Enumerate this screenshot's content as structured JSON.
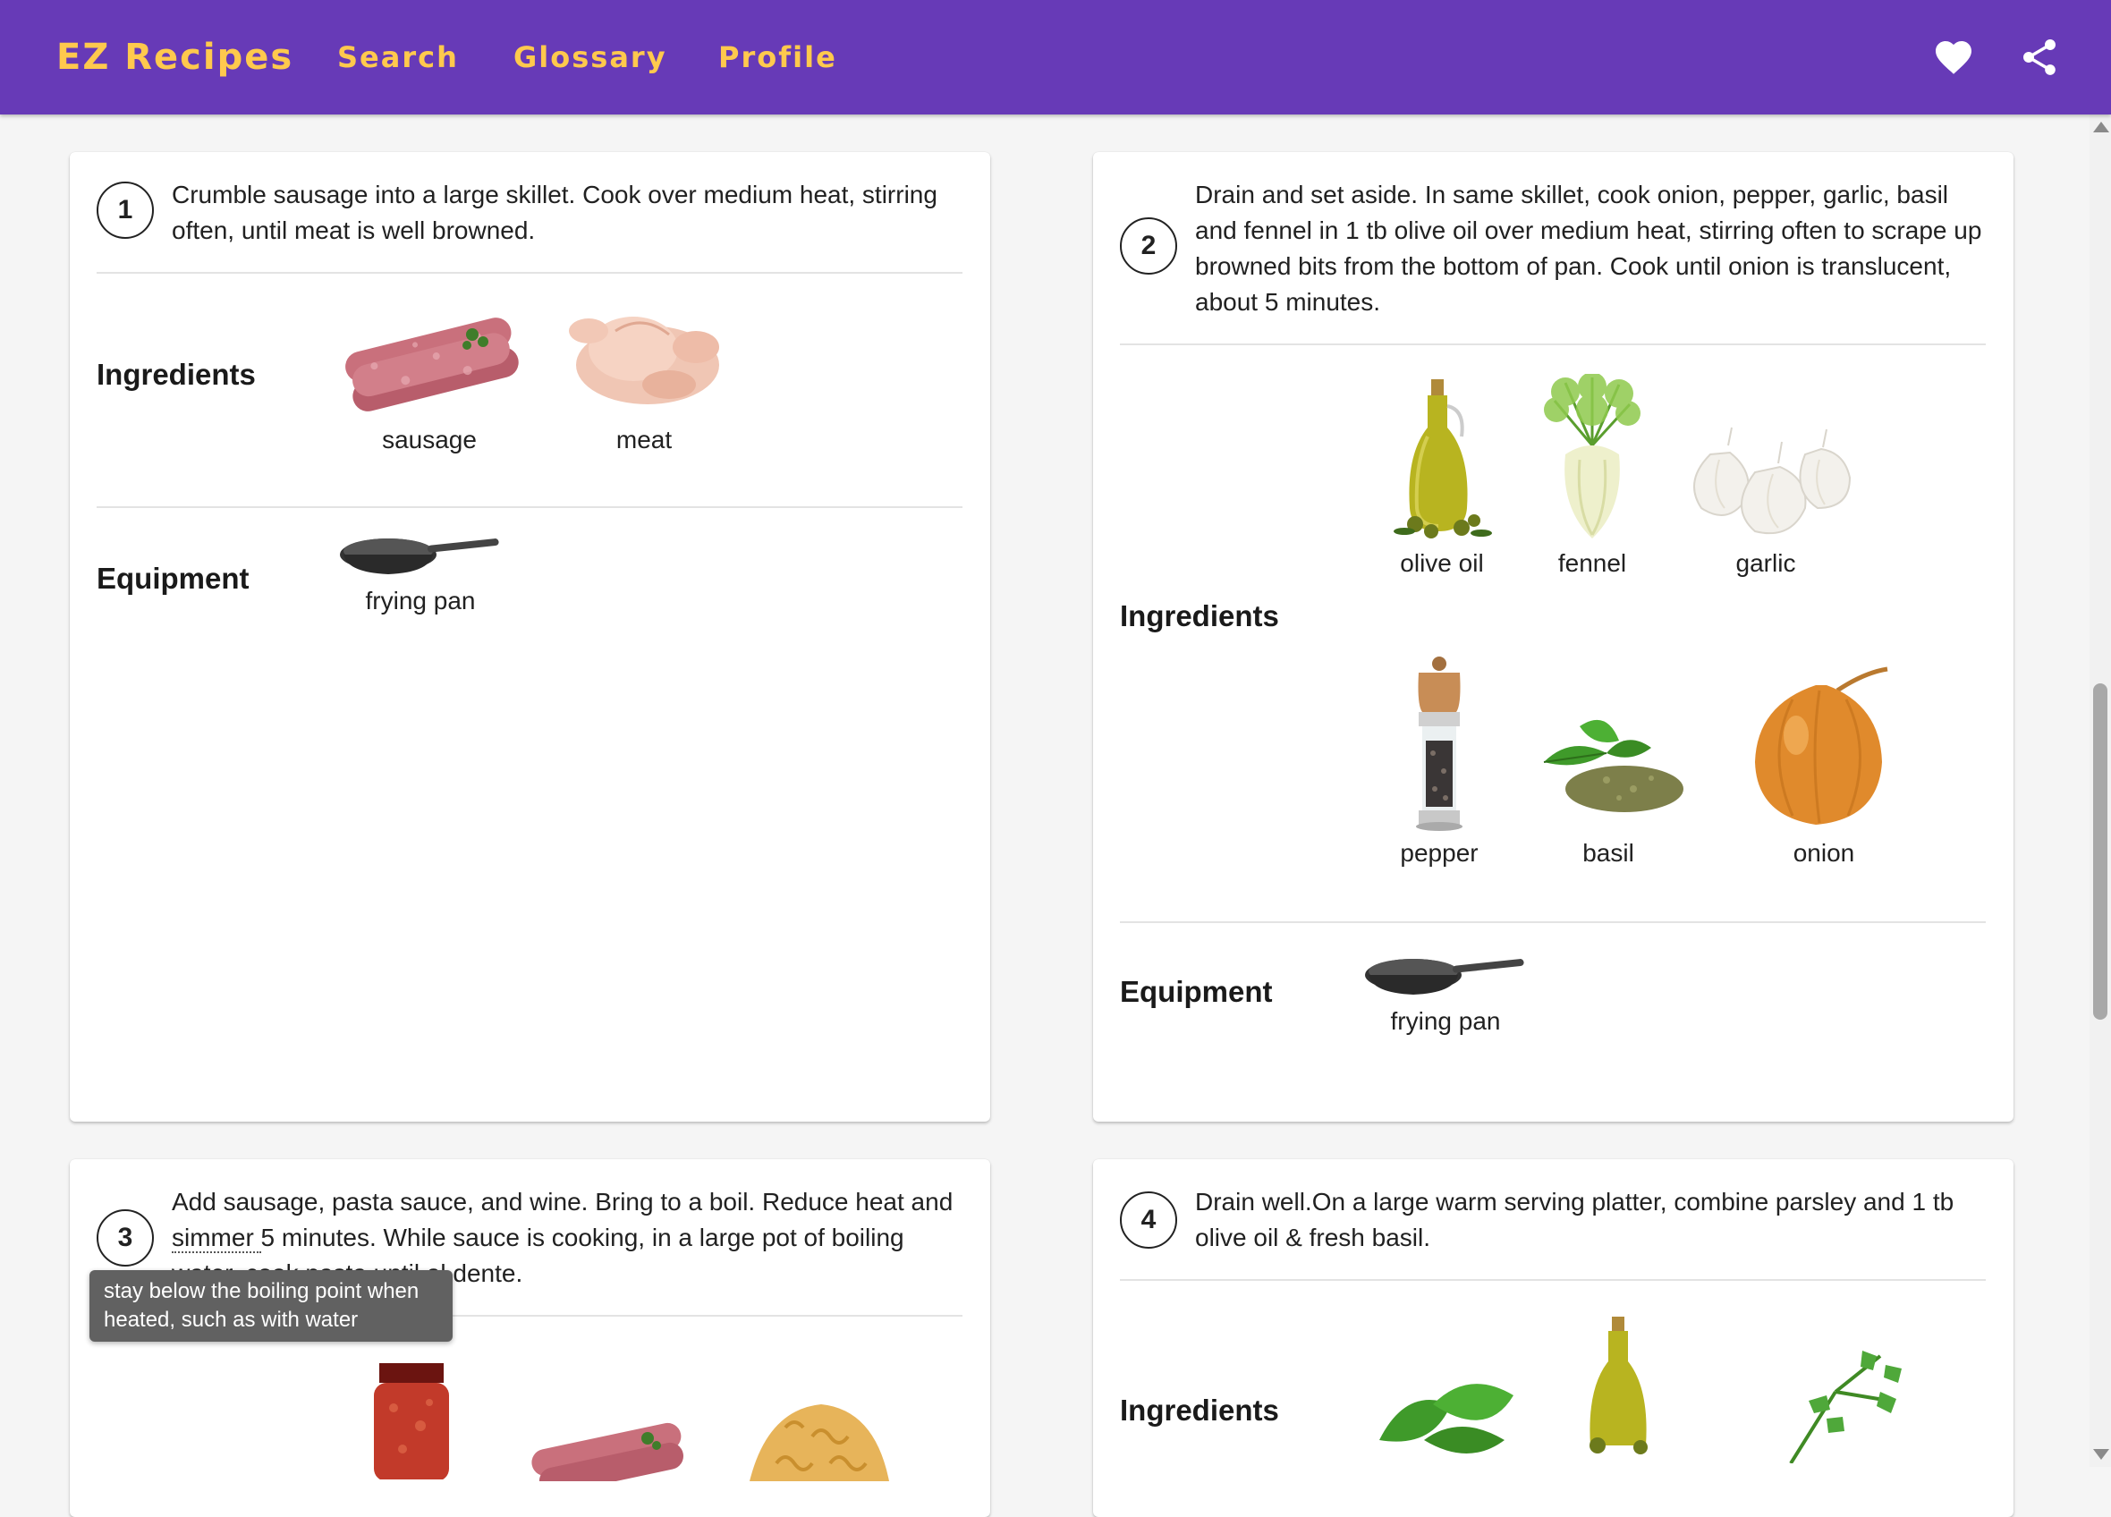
{
  "app": {
    "brand": "EZ Recipes",
    "nav": [
      "Search",
      "Glossary",
      "Profile"
    ],
    "actions": [
      "heart-icon",
      "share-icon"
    ],
    "colors": {
      "appbar": "#673ab7",
      "nav_text": "#ffc94d"
    }
  },
  "labels": {
    "ingredients": "Ingredients",
    "equipment": "Equipment"
  },
  "steps": [
    {
      "number": "1",
      "text": "Crumble sausage into a large skillet. Cook over medium heat, stirring often, until meat is well browned.",
      "ingredients": [
        "sausage",
        "meat"
      ],
      "equipment": [
        "frying pan"
      ]
    },
    {
      "number": "2",
      "text": "Drain and set aside. In same skillet, cook onion, pepper, garlic, basil and fennel in 1 tb olive oil over medium heat, stirring often to scrape up browned bits from the bottom of pan. Cook until onion is translucent, about 5 minutes.",
      "ingredients": [
        "olive oil",
        "fennel",
        "garlic",
        "pepper",
        "basil",
        "onion"
      ],
      "equipment": [
        "frying pan"
      ]
    },
    {
      "number": "3",
      "text_before": "Add sausage, pasta sauce, and wine. Bring to a boil. Reduce heat and ",
      "term": "simmer ",
      "text_after": "5 minutes. While sauce is cooking, in a large pot of boiling water, cook pasta until al dente."
    },
    {
      "number": "4",
      "text": "Drain well.On a large warm serving platter, combine parsley and 1 tb olive oil & fresh basil."
    }
  ],
  "tooltip": "stay below the boiling point when heated, such as with water"
}
